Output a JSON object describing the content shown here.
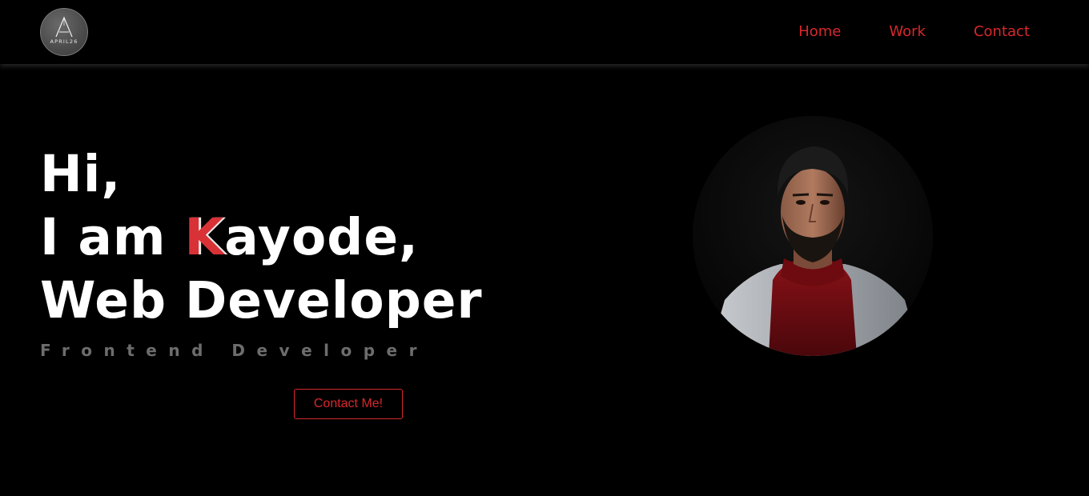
{
  "logo": {
    "text": "APRIL26",
    "letter": "A"
  },
  "nav": {
    "items": [
      "Home",
      "Work",
      "Contact"
    ]
  },
  "hero": {
    "line1": "Hi,",
    "line2_prefix": "I am ",
    "line2_accent": "K",
    "line2_suffix": "ayode,",
    "line3": "Web Developer",
    "subtitle": "Frontend Developer",
    "button_label": "Contact Me!"
  },
  "colors": {
    "background": "#000000",
    "accent": "#d8272c",
    "heading": "#ffffff",
    "subtitle": "#6d6d6d"
  },
  "icons": [
    "logo-emblem-icon",
    "profile-photo"
  ]
}
